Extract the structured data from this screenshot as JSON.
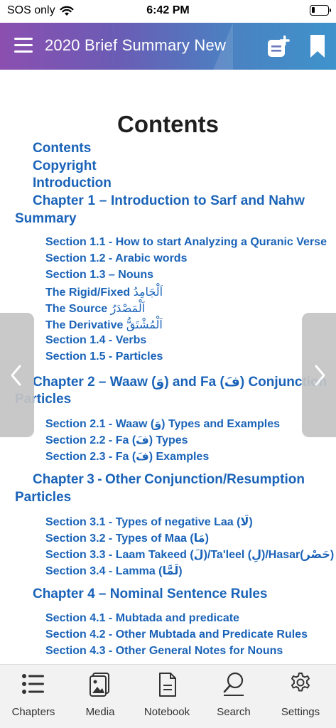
{
  "status_bar": {
    "carrier": "SOS only",
    "time": "6:42 PM",
    "battery_level": 0.2
  },
  "header": {
    "title": "2020 Brief Summary New",
    "icons": [
      "menu-icon",
      "add-note-icon",
      "bookmark-icon"
    ]
  },
  "toc": {
    "title": "Contents",
    "items": [
      {
        "text": "Contents"
      },
      {
        "text": "Copyright"
      },
      {
        "text": "Introduction"
      },
      {
        "words": [
          "Chapter",
          "1",
          "–",
          "Introduction",
          "to",
          "Sarf",
          "and",
          "Nahw"
        ],
        "cont": "Summary"
      },
      {
        "text": "Section 1.1 - How to start Analyzing a Quranic Verse"
      },
      {
        "text": "Section 1.2 - Arabic words"
      },
      {
        "text": "Section 1.3 – Nouns"
      },
      {
        "text": "The Rigid/Fixed ",
        "arabic": "اَلْجَامِدُ"
      },
      {
        "text": "The Source ",
        "arabic": "اَلْمَصْدَرُ"
      },
      {
        "text": "The Derivative ",
        "arabic": "اَلْمُشْتَقُّ"
      },
      {
        "text": "Section 1.4 - Verbs"
      },
      {
        "text": "Section 1.5 - Particles"
      },
      {
        "text": "Chapter 2 – Waaw (وَ) and Fa (فَ) Conjunction",
        "cont": "Particles"
      },
      {
        "text": "Section 2.1 - Waaw (وَ) Types and Examples"
      },
      {
        "text": "Section 2.2 - Fa (فَ) Types"
      },
      {
        "text": "Section 2.3 - Fa (فَ) Examples"
      },
      {
        "words": [
          "Chapter",
          "3",
          "-",
          "Other",
          "Conjunction/Resumption"
        ],
        "cont": "Particles"
      },
      {
        "text": "Section 3.1 - Types of negative Laa (لَا)"
      },
      {
        "text": "Section 3.2 - Types of Maa (مَا)"
      },
      {
        "text": "Section 3.3 - Laam Takeed (لَ)/Ta'leel (لِ)/Hasar(حَصْر)"
      },
      {
        "text": "Section 3.4 - Lamma (لَمَّا)"
      },
      {
        "text": "Chapter 4 – Nominal Sentence Rules"
      },
      {
        "text": "Section 4.1 - Mubtada and predicate"
      },
      {
        "text": "Section 4.2 - Other Mubtada and Predicate Rules"
      },
      {
        "text": "Section 4.3 - Other General Notes for Nouns"
      }
    ]
  },
  "nav": {
    "prev_icon": "chevron-left-icon",
    "next_icon": "chevron-right-icon"
  },
  "tabs": [
    {
      "label": "Chapters",
      "icon": "list-icon"
    },
    {
      "label": "Media",
      "icon": "media-icon"
    },
    {
      "label": "Notebook",
      "icon": "notebook-icon"
    },
    {
      "label": "Search",
      "icon": "search-icon"
    },
    {
      "label": "Settings",
      "icon": "settings-icon"
    }
  ],
  "colors": {
    "link": "#1a63b8",
    "header_start": "#8b4fb0",
    "header_end": "#3e93cc",
    "tabbar": "#f2f2f2"
  }
}
